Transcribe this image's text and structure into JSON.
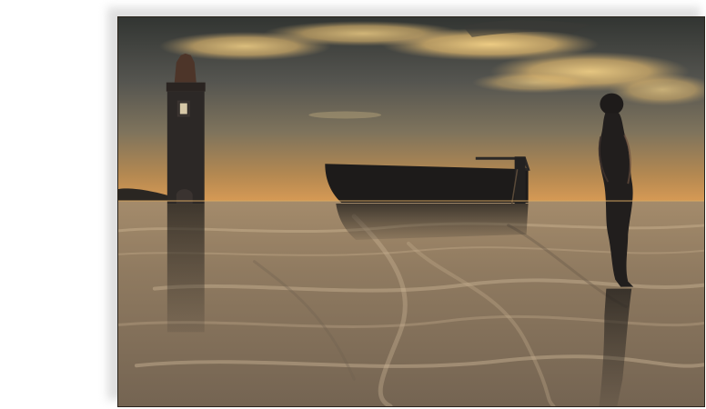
{
  "scene": {
    "subject": "surreal-digital-render",
    "elements": [
      "cloudy-dusk-sky",
      "reflective-water",
      "stone-tower",
      "dark-boat",
      "standing-figure"
    ],
    "colors": {
      "sky_top": "#3c3d3b",
      "sky_mid": "#6f6a58",
      "horizon_glow": "#d19a58",
      "cloud_light": "#f0c678",
      "water_base": "#8e7c63",
      "water_highlight": "#c4ad8d",
      "silhouette": "#1f1d1c",
      "page_background": "#ffffff"
    }
  }
}
